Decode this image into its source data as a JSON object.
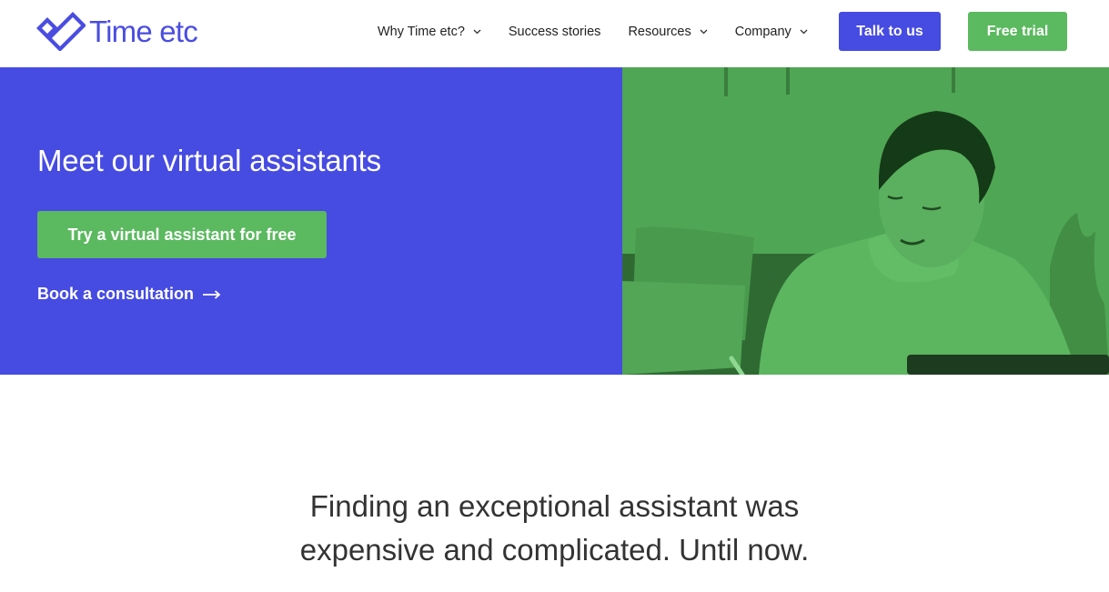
{
  "brand": {
    "name": "Time etc",
    "logo_icon": "checkmark-heart-logo-icon",
    "colors": {
      "primary": "#464be2",
      "logo": "#4a4de0",
      "accent_green": "#5bb95f",
      "photo_tint": "#4fa654",
      "text_dark": "#333333"
    }
  },
  "header": {
    "nav": [
      {
        "label": "Why Time etc?",
        "has_dropdown": true,
        "icon": "chevron-down-icon"
      },
      {
        "label": "Success stories",
        "has_dropdown": false
      },
      {
        "label": "Resources",
        "has_dropdown": true,
        "icon": "chevron-down-icon"
      },
      {
        "label": "Company",
        "has_dropdown": true,
        "icon": "chevron-down-icon"
      }
    ],
    "talk_label": "Talk to us",
    "trial_label": "Free trial"
  },
  "hero": {
    "title": "Meet our virtual assistants",
    "cta_label": "Try a virtual assistant for free",
    "link_label": "Book a consultation",
    "link_icon": "arrow-right-icon",
    "image_alt": "Woman smiling while writing at a desk with a laptop"
  },
  "section": {
    "title_line1": "Finding an exceptional assistant was",
    "title_line2": "expensive and complicated. Until now."
  }
}
